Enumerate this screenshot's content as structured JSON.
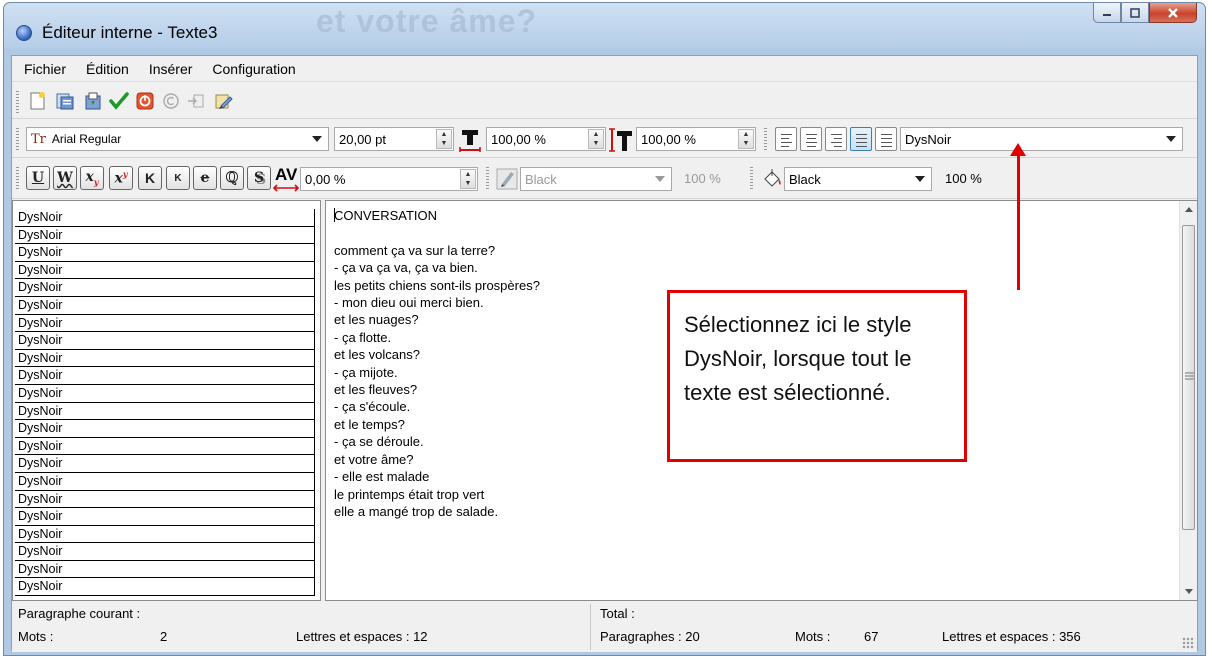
{
  "window": {
    "title": "Éditeur interne - Texte3",
    "ghost_text": "et votre âme?"
  },
  "menu": [
    "Fichier",
    "Édition",
    "Insérer",
    "Configuration"
  ],
  "toolbar_format": {
    "font": "Arial Regular",
    "font_icon_label": "Tr",
    "font_size": "20,00 pt",
    "width_scale": "100,00 %",
    "height_scale": "100,00 %",
    "style": "DysNoir",
    "alignment_active_index": 3
  },
  "toolbar_char": {
    "buttons": [
      "U",
      "W",
      "x",
      "x",
      "K",
      "K",
      "e",
      "Q",
      "S"
    ],
    "spacing_icon_label": "AV",
    "spacing": "0,00 %",
    "text_color": "Black",
    "text_color_opacity": "100 %",
    "fill_color": "Black",
    "fill_color_opacity": "100 %"
  },
  "styles_list": [
    "DysNoir",
    "DysNoir",
    "DysNoir",
    "DysNoir",
    "DysNoir",
    "DysNoir",
    "DysNoir",
    "DysNoir",
    "DysNoir",
    "DysNoir",
    "DysNoir",
    "DysNoir",
    "DysNoir",
    "DysNoir",
    "DysNoir",
    "DysNoir",
    "DysNoir",
    "DysNoir",
    "DysNoir",
    "DysNoir",
    "DysNoir",
    "DysNoir"
  ],
  "editor_lines": [
    "CONVERSATION",
    "",
    "comment ça va sur la terre?",
    "- ça va ça va, ça va bien.",
    "les petits chiens sont-ils prospères?",
    "- mon dieu oui merci bien.",
    "et les nuages?",
    "- ça flotte.",
    "et les volcans?",
    "- ça mijote.",
    "et les fleuves?",
    "- ça s'écoule.",
    "et le temps?",
    "- ça se déroule.",
    "et votre âme?",
    "- elle est malade",
    "le printemps était trop vert",
    "elle a mangé trop de salade."
  ],
  "status": {
    "current_paragraph_label": "Paragraphe courant :",
    "words_label": "Mots :",
    "words_value": "2",
    "letters_label": "Lettres et espaces : 12",
    "total_label": "Total :",
    "paragraphs_total": "Paragraphes : 20",
    "words_total_label": "Mots :",
    "words_total_value": "67",
    "letters_total": "Lettres et espaces : 356"
  },
  "callout": {
    "text": "Sélectionnez ici le style DysNoir, lorsque tout le texte est sélectionné.",
    "border_color": "#e00000"
  }
}
